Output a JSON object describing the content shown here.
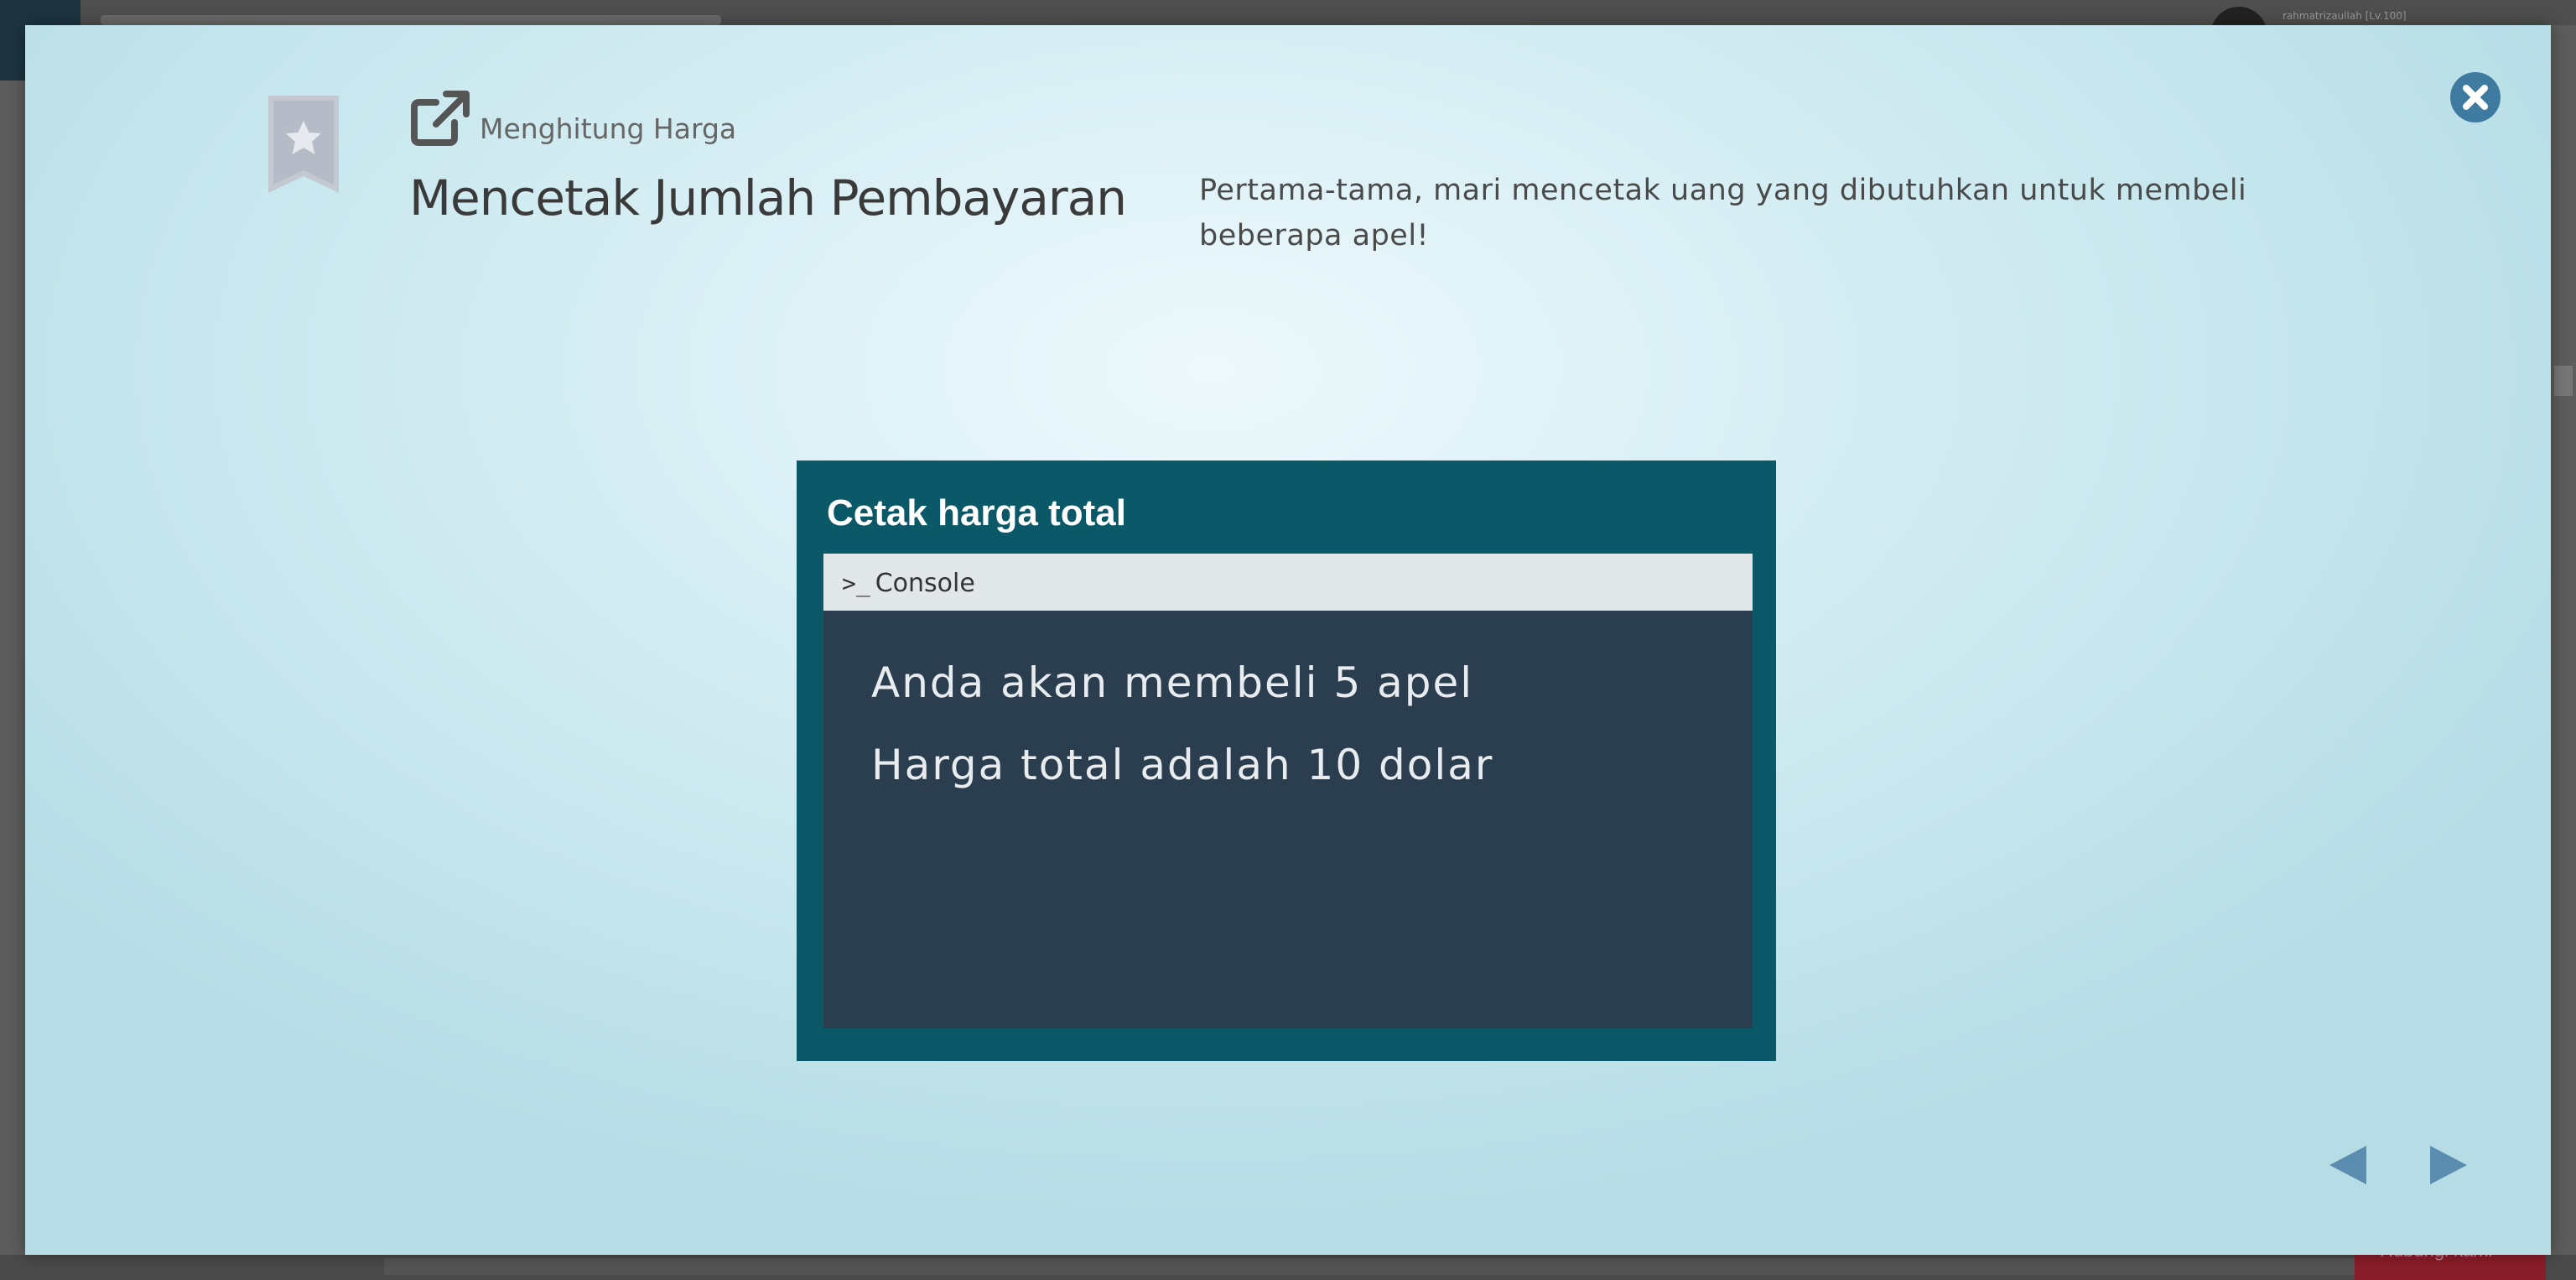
{
  "background": {
    "username": "rahmatrizaullah [Lv.100]",
    "help_button_label": "Hubungi kami"
  },
  "modal": {
    "subtitle": "Menghitung Harga",
    "title": "Mencetak Jumlah Pembayaran",
    "description": "Pertama-tama, mari mencetak uang yang dibutuhkan untuk membeli beberapa apel!",
    "icons": {
      "bookmark": "bookmark-star-icon",
      "external": "external-link-icon",
      "close": "close-icon",
      "prev": "arrow-left-icon",
      "next": "arrow-right-icon"
    },
    "colors": {
      "accent_blue": "#3f7aa1",
      "slide_bg": "#0b5868",
      "console_bg": "#2b3e50"
    }
  },
  "slide": {
    "heading": "Cetak harga total",
    "console": {
      "prompt_symbol": ">_",
      "tab_label": "Console",
      "output_lines": [
        "Anda akan membeli 5 apel",
        "Harga total adalah 10 dolar"
      ]
    }
  }
}
